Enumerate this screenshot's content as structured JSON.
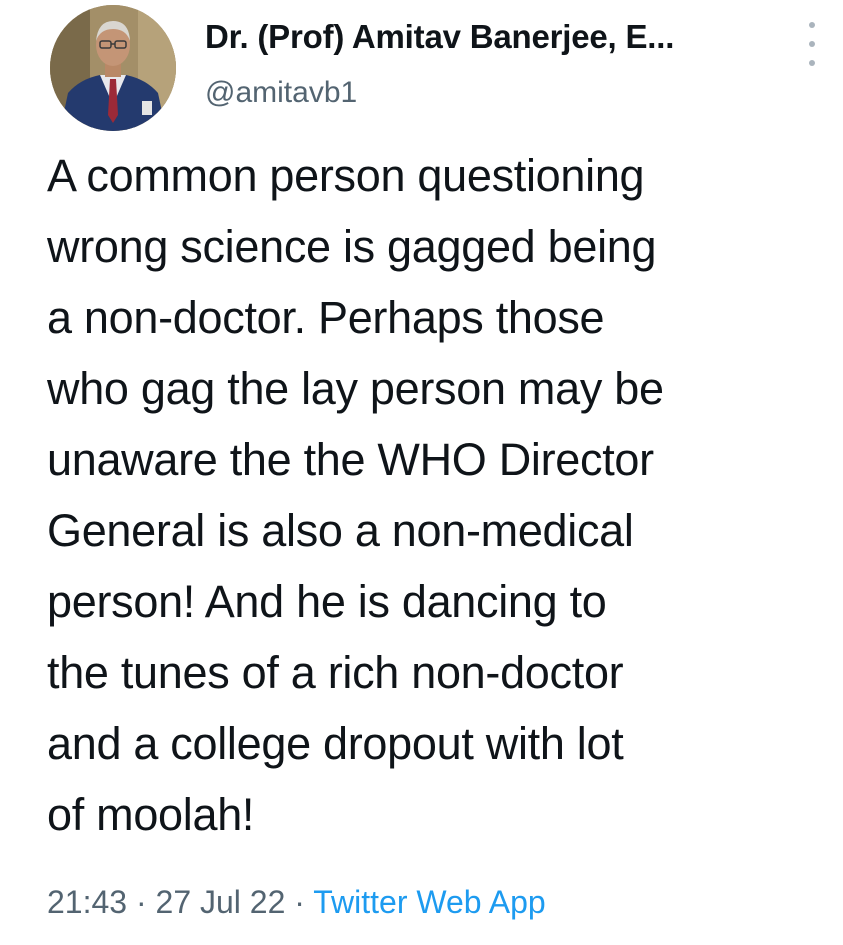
{
  "author": {
    "display_name": "Dr. (Prof) Amitav Banerjee, E...",
    "handle": "@amitavb1"
  },
  "tweet": {
    "lines": [
      "A common person questioning",
      "wrong science is gagged being",
      "a non-doctor. Perhaps those",
      "who gag the lay person may be",
      "unaware the the WHO Director",
      "General is also a non-medical",
      "person! And he is dancing to",
      "the tunes of a rich non-doctor",
      "and a college dropout with lot",
      "of moolah!"
    ],
    "time": "21:43",
    "separator": "·",
    "date": "27 Jul 22",
    "source": "Twitter Web App"
  },
  "icons": {
    "more": "more-vertical-icon"
  },
  "colors": {
    "text": "#0f1419",
    "secondary": "#536471",
    "link": "#1d9bf0"
  }
}
